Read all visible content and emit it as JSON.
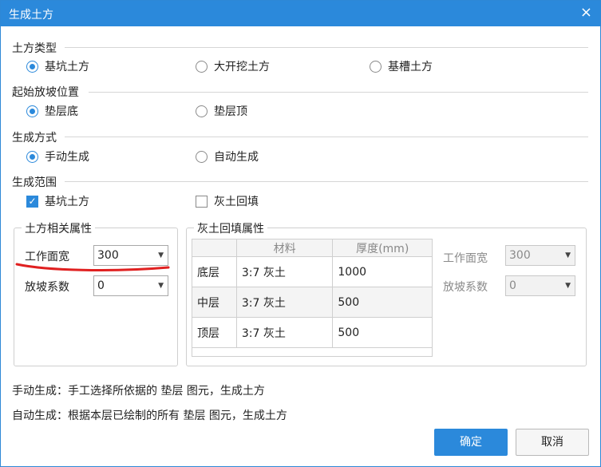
{
  "window": {
    "title": "生成土方",
    "close_glyph": "×"
  },
  "earthwork_type": {
    "label": "土方类型",
    "options": [
      {
        "label": "基坑土方",
        "selected": true
      },
      {
        "label": "大开挖土方",
        "selected": false
      },
      {
        "label": "基槽土方",
        "selected": false
      }
    ]
  },
  "slope_start": {
    "label": "起始放坡位置",
    "options": [
      {
        "label": "垫层底",
        "selected": true
      },
      {
        "label": "垫层顶",
        "selected": false
      }
    ]
  },
  "gen_method": {
    "label": "生成方式",
    "options": [
      {
        "label": "手动生成",
        "selected": true
      },
      {
        "label": "自动生成",
        "selected": false
      }
    ]
  },
  "gen_scope": {
    "label": "生成范围",
    "options": [
      {
        "label": "基坑土方",
        "checked": true,
        "mark": "✓"
      },
      {
        "label": "灰土回填",
        "checked": false,
        "mark": ""
      }
    ]
  },
  "earthwork_props": {
    "legend": "土方相关属性",
    "work_width_label": "工作面宽",
    "work_width_value": "300",
    "slope_coef_label": "放坡系数",
    "slope_coef_value": "0"
  },
  "backfill_props": {
    "legend": "灰土回填属性",
    "columns": [
      "",
      "材料",
      "厚度(mm)"
    ],
    "rows": [
      {
        "layer": "底层",
        "material": "3:7 灰土",
        "thickness": "1000"
      },
      {
        "layer": "中层",
        "material": "3:7 灰土",
        "thickness": "500"
      },
      {
        "layer": "顶层",
        "material": "3:7 灰土",
        "thickness": "500"
      }
    ],
    "work_width_label": "工作面宽",
    "work_width_value": "300",
    "slope_coef_label": "放坡系数",
    "slope_coef_value": "0"
  },
  "notes": {
    "manual": "手动生成：手工选择所依据的 垫层 图元，生成土方",
    "auto": "自动生成：根据本层已绘制的所有 垫层 图元，生成土方"
  },
  "buttons": {
    "ok": "确定",
    "cancel": "取消"
  },
  "colors": {
    "accent": "#2b89db",
    "annotation": "#e02020"
  },
  "arrow_glyph": "▼"
}
